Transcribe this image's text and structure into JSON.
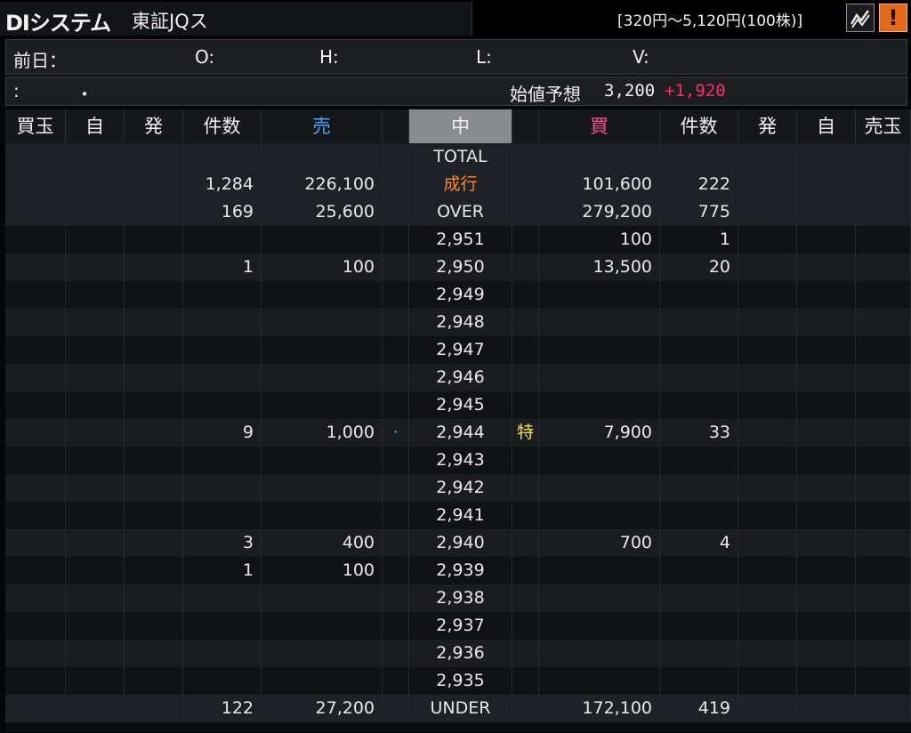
{
  "header": {
    "stock_name": "DIシステム",
    "market": "東証JQス",
    "price_limit": "[320円～5,120円(100株)]",
    "chart_button_icon": "line-chart-icon",
    "alert_button_label": "!",
    "alert_button_icon": "alert-icon"
  },
  "info": {
    "prev_day_label": "前日：",
    "open_label": "O:",
    "high_label": "H:",
    "low_label": "L:",
    "volume_label": "V:",
    "time_colon": ":",
    "time_dot": "・",
    "indicative_label": "始値予想",
    "indicative_price": "3,200",
    "indicative_change": "+1,920"
  },
  "columns": [
    "買玉",
    "自",
    "発",
    "件数",
    "売",
    "",
    "中",
    "",
    "買",
    "件数",
    "発",
    "自",
    "売玉"
  ],
  "colors": {
    "sell_header": "#3fa7ff",
    "buy_header": "#ff4f8e",
    "market_order": "#ff8a1a",
    "special_quote": "#f4e53a",
    "change_positive": "#ff2d6a",
    "selected_header_bg": "#8a8b8e"
  },
  "summary_rows": [
    {
      "sell_count": "",
      "sell_qty": "",
      "label": "TOTAL",
      "buy_qty": "",
      "buy_count": ""
    },
    {
      "sell_count": "1,284",
      "sell_qty": "226,100",
      "label": "成行",
      "buy_qty": "101,600",
      "buy_count": "222"
    },
    {
      "sell_count": "169",
      "sell_qty": "25,600",
      "label": "OVER",
      "buy_qty": "279,200",
      "buy_count": "775"
    }
  ],
  "price_rows": [
    {
      "sell_count": "",
      "sell_qty": "",
      "marker": "",
      "price": "2,951",
      "flag": "",
      "buy_qty": "100",
      "buy_count": "1"
    },
    {
      "sell_count": "1",
      "sell_qty": "100",
      "marker": "",
      "price": "2,950",
      "flag": "",
      "buy_qty": "13,500",
      "buy_count": "20"
    },
    {
      "sell_count": "",
      "sell_qty": "",
      "marker": "",
      "price": "2,949",
      "flag": "",
      "buy_qty": "",
      "buy_count": ""
    },
    {
      "sell_count": "",
      "sell_qty": "",
      "marker": "",
      "price": "2,948",
      "flag": "",
      "buy_qty": "",
      "buy_count": ""
    },
    {
      "sell_count": "",
      "sell_qty": "",
      "marker": "",
      "price": "2,947",
      "flag": "",
      "buy_qty": "",
      "buy_count": ""
    },
    {
      "sell_count": "",
      "sell_qty": "",
      "marker": "",
      "price": "2,946",
      "flag": "",
      "buy_qty": "",
      "buy_count": ""
    },
    {
      "sell_count": "",
      "sell_qty": "",
      "marker": "",
      "price": "2,945",
      "flag": "",
      "buy_qty": "",
      "buy_count": ""
    },
    {
      "sell_count": "9",
      "sell_qty": "1,000",
      "marker": "·",
      "price": "2,944",
      "flag": "特",
      "buy_qty": "7,900",
      "buy_count": "33"
    },
    {
      "sell_count": "",
      "sell_qty": "",
      "marker": "",
      "price": "2,943",
      "flag": "",
      "buy_qty": "",
      "buy_count": ""
    },
    {
      "sell_count": "",
      "sell_qty": "",
      "marker": "",
      "price": "2,942",
      "flag": "",
      "buy_qty": "",
      "buy_count": ""
    },
    {
      "sell_count": "",
      "sell_qty": "",
      "marker": "",
      "price": "2,941",
      "flag": "",
      "buy_qty": "",
      "buy_count": ""
    },
    {
      "sell_count": "3",
      "sell_qty": "400",
      "marker": "",
      "price": "2,940",
      "flag": "",
      "buy_qty": "700",
      "buy_count": "4"
    },
    {
      "sell_count": "1",
      "sell_qty": "100",
      "marker": "",
      "price": "2,939",
      "flag": "",
      "buy_qty": "",
      "buy_count": ""
    },
    {
      "sell_count": "",
      "sell_qty": "",
      "marker": "",
      "price": "2,938",
      "flag": "",
      "buy_qty": "",
      "buy_count": ""
    },
    {
      "sell_count": "",
      "sell_qty": "",
      "marker": "",
      "price": "2,937",
      "flag": "",
      "buy_qty": "",
      "buy_count": ""
    },
    {
      "sell_count": "",
      "sell_qty": "",
      "marker": "",
      "price": "2,936",
      "flag": "",
      "buy_qty": "",
      "buy_count": ""
    },
    {
      "sell_count": "",
      "sell_qty": "",
      "marker": "",
      "price": "2,935",
      "flag": "",
      "buy_qty": "",
      "buy_count": ""
    }
  ],
  "under_row": {
    "sell_count": "122",
    "sell_qty": "27,200",
    "label": "UNDER",
    "buy_qty": "172,100",
    "buy_count": "419"
  }
}
